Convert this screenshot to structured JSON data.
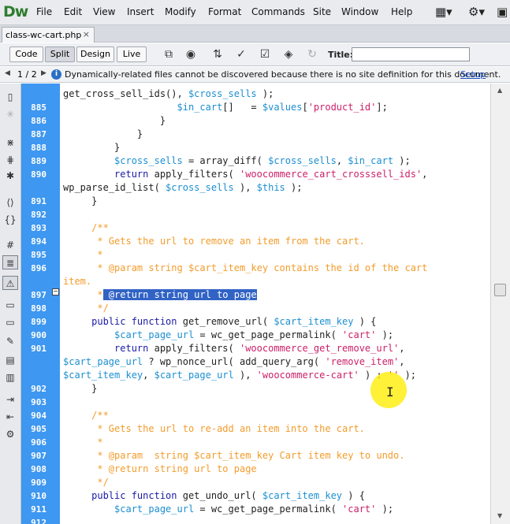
{
  "app": {
    "logo": "Dw",
    "menu": [
      "File",
      "Edit",
      "View",
      "Insert",
      "Modify",
      "Format",
      "Commands",
      "Site",
      "Window",
      "Help"
    ],
    "menu_right_icons": [
      "layout-switcher-icon",
      "gear-icon",
      "workspace-menu-icon"
    ]
  },
  "document_tab": {
    "filename": "class-wc-cart.php",
    "close_glyph": "×"
  },
  "toolbar": {
    "views": [
      "Code",
      "Split",
      "Design",
      "Live"
    ],
    "active_view": "Split",
    "icons": [
      "multiscreen-icon",
      "browser-preview-icon",
      "file-management-icon",
      "w3c-validation-icon",
      "check-page-icon",
      "visual-aids-icon",
      "refresh-icon"
    ],
    "title_label": "Title:",
    "title_value": ""
  },
  "infobar": {
    "page_count": "1 / 2",
    "message": "Dynamically-related files cannot be discovered because there is no site definition for this document.",
    "link": "Setup"
  },
  "editor": {
    "gutter_color": "#3e97f0",
    "selection_color": "#3163c5",
    "lines": [
      {
        "num": "",
        "tokens": [
          {
            "t": "d",
            "x": "get_cross_sell_ids(), "
          },
          {
            "t": "v",
            "x": "$cross_sells"
          },
          {
            "t": "d",
            "x": " );"
          }
        ]
      },
      {
        "num": "885",
        "tokens": [
          {
            "t": "d",
            "x": "                    "
          },
          {
            "t": "v",
            "x": "$in_cart"
          },
          {
            "t": "d",
            "x": "[]   = "
          },
          {
            "t": "v",
            "x": "$values"
          },
          {
            "t": "d",
            "x": "["
          },
          {
            "t": "s",
            "x": "'product_id'"
          },
          {
            "t": "d",
            "x": "];"
          }
        ]
      },
      {
        "num": "886",
        "tokens": [
          {
            "t": "d",
            "x": "                 }"
          }
        ]
      },
      {
        "num": "887",
        "tokens": [
          {
            "t": "d",
            "x": "             }"
          }
        ]
      },
      {
        "num": "888",
        "tokens": [
          {
            "t": "d",
            "x": "         }"
          }
        ]
      },
      {
        "num": "889",
        "tokens": [
          {
            "t": "d",
            "x": "         "
          },
          {
            "t": "v",
            "x": "$cross_sells"
          },
          {
            "t": "d",
            "x": " = array_diff( "
          },
          {
            "t": "v",
            "x": "$cross_sells"
          },
          {
            "t": "d",
            "x": ", "
          },
          {
            "t": "v",
            "x": "$in_cart"
          },
          {
            "t": "d",
            "x": " );"
          }
        ]
      },
      {
        "num": "890",
        "tokens": [
          {
            "t": "d",
            "x": "         "
          },
          {
            "t": "k",
            "x": "return"
          },
          {
            "t": "d",
            "x": " apply_filters( "
          },
          {
            "t": "s",
            "x": "'woocommerce_cart_crosssell_ids'"
          },
          {
            "t": "d",
            "x": ","
          }
        ]
      },
      {
        "num": "",
        "tokens": [
          {
            "t": "d",
            "x": "wp_parse_id_list( "
          },
          {
            "t": "v",
            "x": "$cross_sells"
          },
          {
            "t": "d",
            "x": " ), "
          },
          {
            "t": "v",
            "x": "$this"
          },
          {
            "t": "d",
            "x": " );"
          }
        ]
      },
      {
        "num": "891",
        "tokens": [
          {
            "t": "d",
            "x": "     }"
          }
        ]
      },
      {
        "num": "892",
        "tokens": []
      },
      {
        "num": "893",
        "tokens": [
          {
            "t": "c",
            "x": "     /**"
          }
        ]
      },
      {
        "num": "894",
        "tokens": [
          {
            "t": "c",
            "x": "      * Gets the url to remove an item from the cart."
          }
        ]
      },
      {
        "num": "895",
        "tokens": [
          {
            "t": "c",
            "x": "      *"
          }
        ]
      },
      {
        "num": "896",
        "tokens": [
          {
            "t": "c",
            "x": "      * @param string $cart_item_key contains the id of the cart"
          }
        ]
      },
      {
        "num": "",
        "tokens": [
          {
            "t": "c",
            "x": "item."
          }
        ]
      },
      {
        "num": "897",
        "tokens": [
          {
            "t": "c",
            "x": "      *"
          },
          {
            "t": "sel",
            "x": " @return string url to page"
          }
        ]
      },
      {
        "num": "898",
        "tokens": [
          {
            "t": "c",
            "x": "      */"
          }
        ]
      },
      {
        "num": "899",
        "tokens": [
          {
            "t": "d",
            "x": "     "
          },
          {
            "t": "k",
            "x": "public function"
          },
          {
            "t": "d",
            "x": " get_remove_url( "
          },
          {
            "t": "v",
            "x": "$cart_item_key"
          },
          {
            "t": "d",
            "x": " ) {"
          }
        ]
      },
      {
        "num": "900",
        "tokens": [
          {
            "t": "d",
            "x": "         "
          },
          {
            "t": "v",
            "x": "$cart_page_url"
          },
          {
            "t": "d",
            "x": " = wc_get_page_permalink( "
          },
          {
            "t": "s",
            "x": "'cart'"
          },
          {
            "t": "d",
            "x": " );"
          }
        ]
      },
      {
        "num": "901",
        "tokens": [
          {
            "t": "d",
            "x": "         "
          },
          {
            "t": "k",
            "x": "return"
          },
          {
            "t": "d",
            "x": " apply_filters( "
          },
          {
            "t": "s",
            "x": "'woocommerce_get_remove_url'"
          },
          {
            "t": "d",
            "x": ","
          }
        ]
      },
      {
        "num": "",
        "tokens": [
          {
            "t": "v",
            "x": "$cart_page_url"
          },
          {
            "t": "d",
            "x": " ? wp_nonce_url( add_query_arg( "
          },
          {
            "t": "s",
            "x": "'remove_item'"
          },
          {
            "t": "d",
            "x": ","
          }
        ]
      },
      {
        "num": "",
        "tokens": [
          {
            "t": "v",
            "x": "$cart_item_key"
          },
          {
            "t": "d",
            "x": ", "
          },
          {
            "t": "v",
            "x": "$cart_page_url"
          },
          {
            "t": "d",
            "x": " ), "
          },
          {
            "t": "s",
            "x": "'woocommerce-cart'"
          },
          {
            "t": "d",
            "x": " ) : "
          },
          {
            "t": "s",
            "x": "''"
          },
          {
            "t": "d",
            "x": " );"
          }
        ]
      },
      {
        "num": "902",
        "tokens": [
          {
            "t": "d",
            "x": "     }"
          }
        ]
      },
      {
        "num": "903",
        "tokens": []
      },
      {
        "num": "904",
        "tokens": [
          {
            "t": "c",
            "x": "     /**"
          }
        ]
      },
      {
        "num": "905",
        "tokens": [
          {
            "t": "c",
            "x": "      * Gets the url to re-add an item into the cart."
          }
        ]
      },
      {
        "num": "906",
        "tokens": [
          {
            "t": "c",
            "x": "      *"
          }
        ]
      },
      {
        "num": "907",
        "tokens": [
          {
            "t": "c",
            "x": "      * @param  string $cart_item_key Cart item key to undo."
          }
        ]
      },
      {
        "num": "908",
        "tokens": [
          {
            "t": "c",
            "x": "      * @return string url to page"
          }
        ]
      },
      {
        "num": "909",
        "tokens": [
          {
            "t": "c",
            "x": "      */"
          }
        ]
      },
      {
        "num": "910",
        "tokens": [
          {
            "t": "d",
            "x": "     "
          },
          {
            "t": "k",
            "x": "public function"
          },
          {
            "t": "d",
            "x": " get_undo_url( "
          },
          {
            "t": "v",
            "x": "$cart_item_key"
          },
          {
            "t": "d",
            "x": " ) {"
          }
        ]
      },
      {
        "num": "911",
        "tokens": [
          {
            "t": "d",
            "x": "         "
          },
          {
            "t": "v",
            "x": "$cart_page_url"
          },
          {
            "t": "d",
            "x": " = wc_get_page_permalink( "
          },
          {
            "t": "s",
            "x": "'cart'"
          },
          {
            "t": "d",
            "x": " );"
          }
        ]
      },
      {
        "num": "912",
        "tokens": []
      }
    ]
  },
  "left_toolbar_icons": [
    "open-documents-icon",
    "collapse-full-tag-icon",
    "collapse-selection-icon",
    "expand-all-icon",
    "select-parent-tag-icon",
    "balance-braces-icon",
    "line-numbers-icon",
    "highlight-invalid-code-icon",
    "syntax-coloring-icon",
    "info-warning-icon",
    "apply-comment-icon",
    "remove-comment-icon",
    "wrap-tag-icon",
    "recent-snippets-icon",
    "move-css-icon",
    "indent-code-icon",
    "outdent-code-icon",
    "format-source-code-icon"
  ]
}
